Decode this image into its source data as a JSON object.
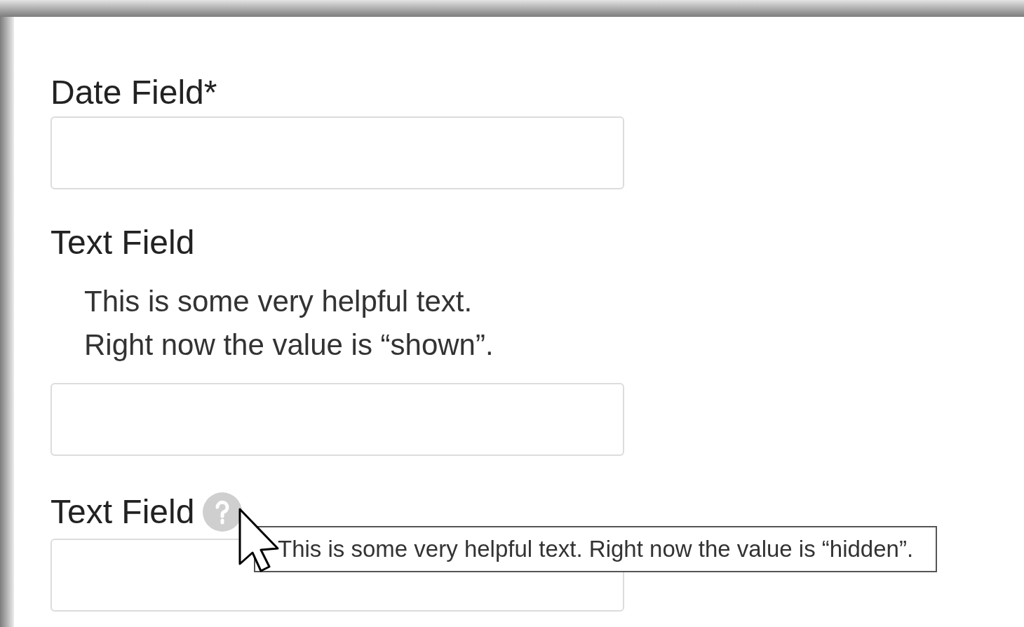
{
  "fields": [
    {
      "kind": "plain",
      "label": "Date Field*"
    },
    {
      "kind": "inline_help",
      "label": "Text Field",
      "help": [
        "This is some very helpful text.",
        "Right now the value is “shown”."
      ]
    },
    {
      "kind": "tooltip_help",
      "label": "Text Field",
      "tooltip": "This is some very helpful text. Right now the value is “hidden”."
    }
  ]
}
